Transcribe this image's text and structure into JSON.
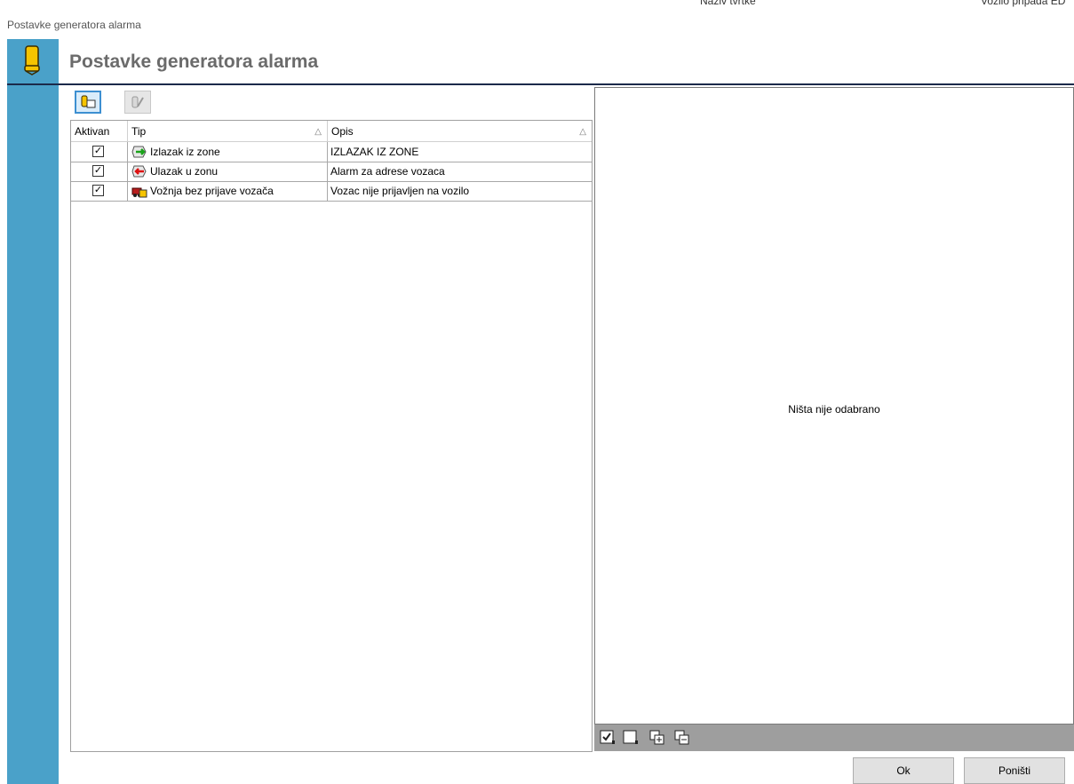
{
  "window": {
    "title": "Postavke generatora alarma"
  },
  "header": {
    "title": "Postavke generatora alarma"
  },
  "background_strip": {
    "left_text": "Naziv tvrtke",
    "right_text": "Vozilo pripada ED"
  },
  "toolbar": {
    "add_icon": "add-alarm-icon",
    "edit_icon": "edit-alarm-icon"
  },
  "grid": {
    "columns": {
      "aktivan": "Aktivan",
      "tip": "Tip",
      "opis": "Opis"
    },
    "rows": [
      {
        "aktivan": true,
        "tip": "Izlazak iz zone",
        "opis": "IZLAZAK IZ ZONE",
        "icon": "zone-exit-icon"
      },
      {
        "aktivan": true,
        "tip": "Ulazak u zonu",
        "opis": "Alarm za adrese vozaca",
        "icon": "zone-enter-icon"
      },
      {
        "aktivan": true,
        "tip": "Vožnja bez prijave vozača",
        "opis": "Vozac nije prijavljen na vozilo",
        "icon": "driver-id-icon"
      }
    ]
  },
  "detail_panel": {
    "empty_text": "Ništa nije odabrano"
  },
  "buttons": {
    "ok": "Ok",
    "cancel": "Poništi"
  },
  "colors": {
    "accent_bar": "#4aa1c9",
    "header_rule": "#1b2a4a",
    "panel_toolbar": "#9e9e9e"
  }
}
